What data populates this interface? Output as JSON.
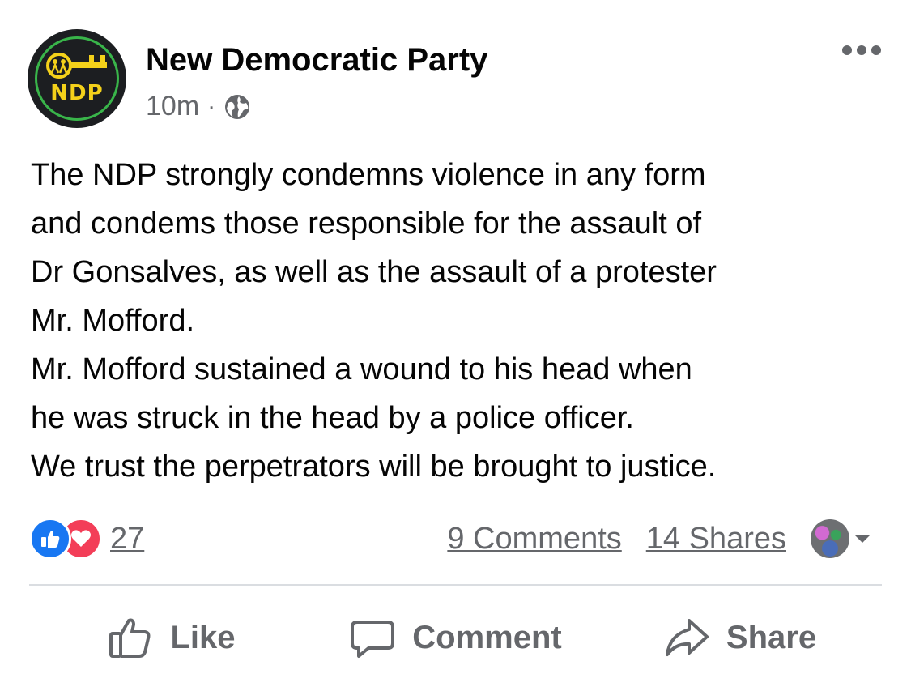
{
  "post": {
    "page_name": "New Democratic Party",
    "avatar_text": "NDP",
    "timestamp": "10m",
    "separator": "·",
    "privacy_icon": "globe-icon",
    "more_icon": "more-horizontal-icon",
    "body_lines": [
      "The NDP strongly condemns violence in any form",
      "and condems those responsible for the assault of",
      "Dr Gonsalves, as well as the assault of a protester",
      "Mr. Mofford.",
      "Mr. Mofford sustained a wound to his head when",
      "he was struck in the head by a police officer.",
      "We trust the perpetrators will be brought to justice."
    ]
  },
  "engagement": {
    "reaction_icons": [
      "like-reaction-icon",
      "love-reaction-icon"
    ],
    "reaction_count": "27",
    "comments": "9 Comments",
    "shares": "14 Shares"
  },
  "actions": {
    "like": "Like",
    "comment": "Comment",
    "share": "Share"
  },
  "colors": {
    "brand_blue": "#1877f2",
    "love_red": "#f33e58",
    "secondary_text": "#65676b",
    "ndp_green": "#39b54a",
    "ndp_yellow": "#f4d11a"
  }
}
